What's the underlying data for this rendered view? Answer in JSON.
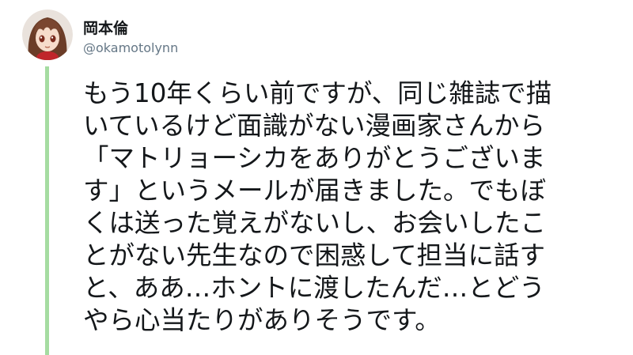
{
  "tweet": {
    "author_name": "岡本倫",
    "author_handle": "@okamotolynn",
    "body_lines": [
      "もう10年くらい前ですが、同じ雑誌で描",
      "いているけど面識がない漫画家さんから",
      "「マトリョーシカをありがとうございま",
      "す」というメールが届きました。でもぼ",
      "くは送った覚えがないし、お会いしたこ",
      "とがない先生なので困惑して担当に話す",
      "と、ああ…ホントに渡したんだ…とどう",
      "やら心当たりがありそうです。"
    ]
  },
  "colors": {
    "thread_line": "#a5dca1",
    "handle_text": "#657786",
    "body_text": "#14171a"
  }
}
